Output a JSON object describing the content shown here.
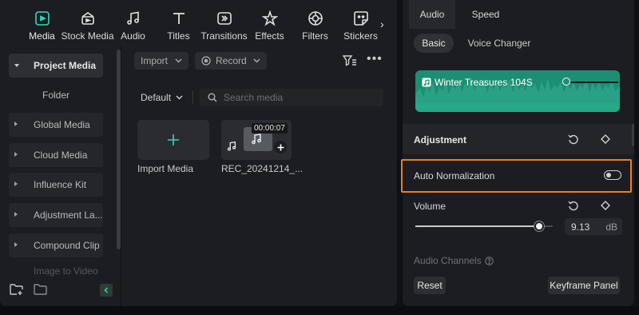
{
  "toolbar": {
    "tabs": [
      {
        "label": "Media",
        "icon": "media-icon",
        "active": true
      },
      {
        "label": "Stock Media",
        "icon": "stock-media-icon"
      },
      {
        "label": "Audio",
        "icon": "audio-icon"
      },
      {
        "label": "Titles",
        "icon": "titles-icon"
      },
      {
        "label": "Transitions",
        "icon": "transitions-icon"
      },
      {
        "label": "Effects",
        "icon": "effects-icon"
      },
      {
        "label": "Filters",
        "icon": "filters-icon"
      },
      {
        "label": "Stickers",
        "icon": "stickers-icon"
      }
    ],
    "more": "›",
    "accent": "#33d6b8"
  },
  "sidebar": {
    "project_media": "Project Media",
    "folder": "Folder",
    "items": [
      "Global Media",
      "Cloud Media",
      "Influence Kit",
      "Adjustment La...",
      "Compound Clip"
    ],
    "faded_item": "Image to Video"
  },
  "media": {
    "import_label": "Import",
    "record_label": "Record",
    "sort_label": "Default",
    "search_placeholder": "Search media",
    "items": [
      {
        "label": "Import Media"
      },
      {
        "label": "REC_20241214_...",
        "duration": "00:00:07"
      }
    ]
  },
  "right": {
    "tabs": [
      "Audio",
      "Speed"
    ],
    "subtabs": [
      "Basic",
      "Voice Changer"
    ],
    "track_title": "Winter Treasures 104S",
    "adjustment": "Adjustment",
    "auto_normalization": "Auto Normalization",
    "volume_label": "Volume",
    "volume_value": "9.13",
    "volume_unit": "dB",
    "volume_level": 0.9,
    "audio_channels": "Audio Channels",
    "reset": "Reset",
    "keyframe_panel": "Keyframe Panel",
    "highlight_color": "#f07d1f"
  }
}
